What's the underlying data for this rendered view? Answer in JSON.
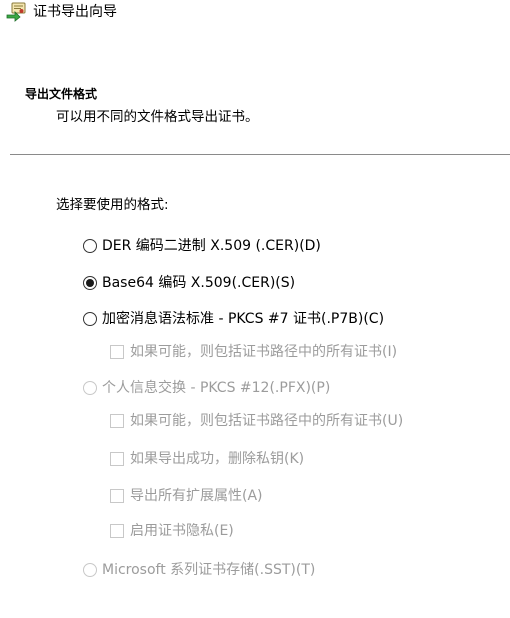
{
  "window": {
    "title": "证书导出向导",
    "icon": "certificate-export-wizard-icon"
  },
  "header": {
    "heading": "导出文件格式",
    "description": "可以用不同的文件格式导出证书。"
  },
  "main": {
    "prompt": "选择要使用的格式:",
    "options": {
      "der": {
        "label": "DER 编码二进制 X.509 (.CER)(D)",
        "checked": false,
        "enabled": true
      },
      "base64": {
        "label": "Base64 编码 X.509(.CER)(S)",
        "checked": true,
        "enabled": true
      },
      "pkcs7": {
        "label": "加密消息语法标准 - PKCS #7 证书(.P7B)(C)",
        "checked": false,
        "enabled": true
      },
      "pkcs7_include_chain": {
        "label": "如果可能，则包括证书路径中的所有证书(I)",
        "checked": false,
        "enabled": false
      },
      "pfx": {
        "label": "个人信息交换 - PKCS #12(.PFX)(P)",
        "checked": false,
        "enabled": false
      },
      "pfx_include_chain": {
        "label": "如果可能，则包括证书路径中的所有证书(U)",
        "checked": false,
        "enabled": false
      },
      "pfx_delete_key": {
        "label": "如果导出成功，删除私钥(K)",
        "checked": false,
        "enabled": false
      },
      "pfx_export_props": {
        "label": "导出所有扩展属性(A)",
        "checked": false,
        "enabled": false
      },
      "pfx_enable_privacy": {
        "label": "启用证书隐私(E)",
        "checked": false,
        "enabled": false
      },
      "sst": {
        "label": "Microsoft 系列证书存储(.SST)(T)",
        "checked": false,
        "enabled": false
      }
    }
  },
  "colors": {
    "text": "#000000",
    "disabled_text": "#9c9c9c",
    "separator": "#8a8a8a",
    "background": "#ffffff"
  }
}
